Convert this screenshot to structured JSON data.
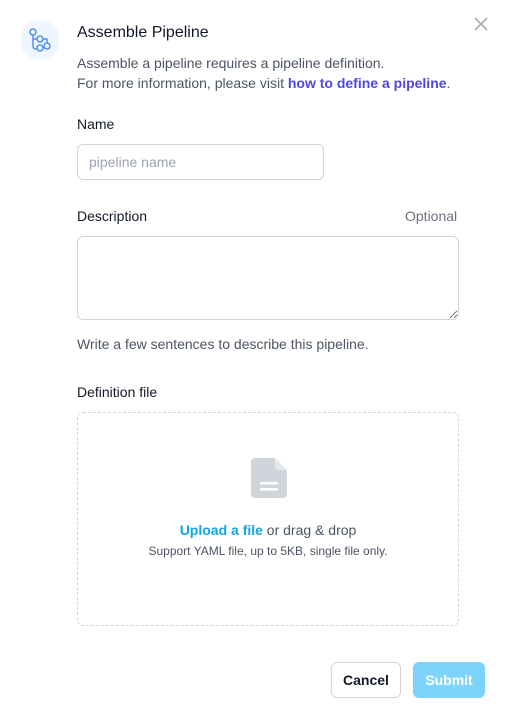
{
  "dialog": {
    "title": "Assemble Pipeline",
    "subtitle_line1": "Assemble a pipeline requires a pipeline definition.",
    "subtitle_line2_prefix": "For more information, please visit ",
    "subtitle_link": "how to define a pipeline",
    "subtitle_line2_suffix": ".",
    "header_icon": "pipeline-icon",
    "close_icon": "close-icon"
  },
  "form": {
    "name_label": "Name",
    "name_placeholder": "pipeline name",
    "name_value": "",
    "description_label": "Description",
    "description_optional": "Optional",
    "description_value": "",
    "description_help": "Write a few sentences to describe this pipeline.",
    "definition_label": "Definition file",
    "upload_link": "Upload a file",
    "upload_suffix": " or drag & drop",
    "upload_hint": "Support YAML file, up to 5KB, single file only.",
    "file_icon": "document-icon"
  },
  "actions": {
    "cancel_label": "Cancel",
    "submit_label": "Submit"
  },
  "colors": {
    "accent_link": "#4f46e5",
    "upload_link": "#0ea5e9",
    "submit_disabled": "#7dd3fc"
  }
}
